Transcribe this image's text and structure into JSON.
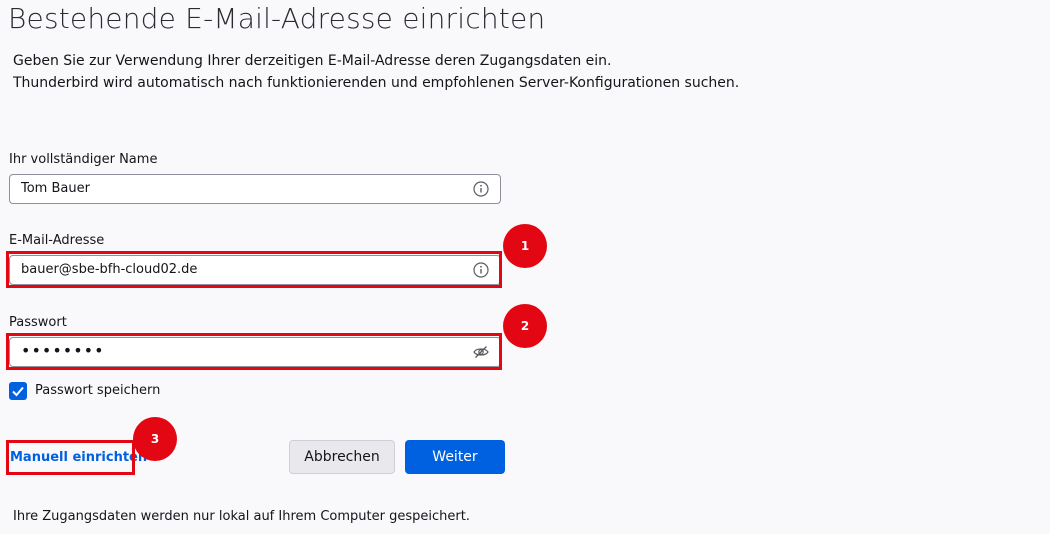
{
  "header": {
    "title": "Bestehende E-Mail-Adresse einrichten",
    "description_line1": "Geben Sie zur Verwendung Ihrer derzeitigen E-Mail-Adresse deren Zugangsdaten ein.",
    "description_line2": "Thunderbird wird automatisch nach funktionierenden und empfohlenen Server-Konfigurationen suchen."
  },
  "form": {
    "name": {
      "label": "Ihr vollständiger Name",
      "value": "Tom Bauer",
      "icon": "info-icon"
    },
    "email": {
      "label": "E-Mail-Adresse",
      "value": "bauer@sbe-bfh-cloud02.de",
      "icon": "info-icon"
    },
    "password": {
      "label": "Passwort",
      "value": "••••••••",
      "icon": "eye-off-icon"
    },
    "remember": {
      "label": "Passwort speichern",
      "checked": true
    }
  },
  "actions": {
    "manual_link": "Manuell einrichten",
    "cancel_label": "Abbrechen",
    "next_label": "Weiter"
  },
  "footer": {
    "note": "Ihre Zugangsdaten werden nur lokal auf Ihrem Computer gespeichert."
  },
  "annotations": {
    "badge1": "1",
    "badge2": "2",
    "badge3": "3",
    "color": "#e30613"
  },
  "colors": {
    "accent": "#0061e0",
    "background": "#f9f9fb"
  }
}
